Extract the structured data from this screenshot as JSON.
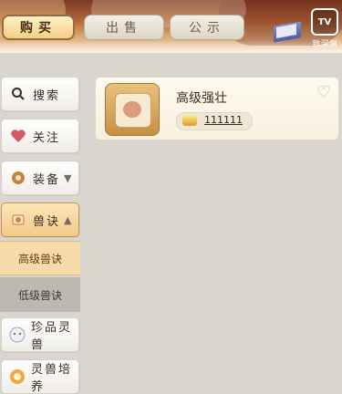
{
  "tabs": [
    {
      "label": "购买"
    },
    {
      "label": "出售"
    },
    {
      "label": "公示"
    }
  ],
  "top_right": {
    "text": "致深渊"
  },
  "sidebar": {
    "items": [
      {
        "label": "搜索",
        "icon": "search-icon"
      },
      {
        "label": "关注",
        "icon": "heart-icon"
      },
      {
        "label": "装备",
        "icon": "equipment-icon"
      },
      {
        "label": "兽诀",
        "icon": "scroll-icon"
      },
      {
        "label": "高级兽诀"
      },
      {
        "label": "低级兽诀"
      },
      {
        "label": "珍品灵兽",
        "icon": "beast-icon"
      },
      {
        "label": "灵兽培养",
        "icon": "cultivate-icon"
      }
    ]
  },
  "listing": {
    "name": "高级强壮",
    "price": "111111"
  },
  "colors": {
    "accent": "#f4cf84",
    "selected_sub": "#f6dba8"
  }
}
